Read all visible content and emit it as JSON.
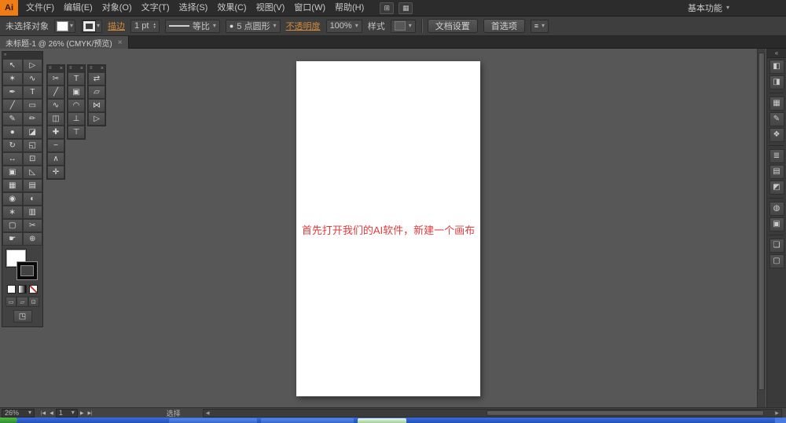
{
  "colors": {
    "accent_orange": "#cf8a3c",
    "annotation_red": "#e03a3a",
    "logo_orange": "#ef7d16",
    "taskbar_blue": "#2f5fd3",
    "artboard_white": "#ffffff"
  },
  "glyphs": {
    "caret_down": "▾",
    "close": "×",
    "collapse": "«",
    "grip": "≡",
    "stepper_up": "▴",
    "stepper_down": "▾",
    "nav_first": "|◀",
    "nav_prev": "◀",
    "nav_next": "▶",
    "nav_last": "▶|"
  },
  "menu_bar": {
    "logo": "Ai",
    "items": [
      "文件(F)",
      "编辑(E)",
      "对象(O)",
      "文字(T)",
      "选择(S)",
      "效果(C)",
      "视图(V)",
      "窗口(W)",
      "帮助(H)"
    ],
    "app_icons": [
      {
        "name": "bridge-icon",
        "glyph": "⊞"
      },
      {
        "name": "arrange-documents-icon",
        "glyph": "▦"
      }
    ],
    "workspace": "基本功能"
  },
  "control_bar": {
    "selection_status": "未选择对象",
    "stroke_link": "描边",
    "stroke_weight": "1 pt",
    "profile_value": "等比",
    "brush_icon": "●",
    "brush_value": "5 点圆形",
    "opacity_link": "不透明度",
    "opacity_value": "100%",
    "style_label": "样式",
    "doc_setup_button": "文档设置",
    "preferences_button": "首选项"
  },
  "document_tab": {
    "title": "未标题-1 @ 26% (CMYK/预览)"
  },
  "toolbar": {
    "tools": [
      {
        "name": "selection-tool",
        "glyph": "↖"
      },
      {
        "name": "direct-selection-tool",
        "glyph": "▷"
      },
      {
        "name": "magic-wand-tool",
        "glyph": "✶"
      },
      {
        "name": "lasso-tool",
        "glyph": "∿"
      },
      {
        "name": "pen-tool",
        "glyph": "✒"
      },
      {
        "name": "type-tool",
        "glyph": "T"
      },
      {
        "name": "line-segment-tool",
        "glyph": "╱"
      },
      {
        "name": "rectangle-tool",
        "glyph": "▭"
      },
      {
        "name": "paintbrush-tool",
        "glyph": "✎"
      },
      {
        "name": "pencil-tool",
        "glyph": "✏"
      },
      {
        "name": "blob-brush-tool",
        "glyph": "●"
      },
      {
        "name": "eraser-tool",
        "glyph": "◪"
      },
      {
        "name": "rotate-tool",
        "glyph": "↻"
      },
      {
        "name": "scale-tool",
        "glyph": "◱"
      },
      {
        "name": "width-tool",
        "glyph": "↔"
      },
      {
        "name": "free-transform-tool",
        "glyph": "⊡"
      },
      {
        "name": "shape-builder-tool",
        "glyph": "▣"
      },
      {
        "name": "perspective-grid-tool",
        "glyph": "◺"
      },
      {
        "name": "mesh-tool",
        "glyph": "▦"
      },
      {
        "name": "gradient-tool",
        "glyph": "▤"
      },
      {
        "name": "eyedropper-tool",
        "glyph": "◉"
      },
      {
        "name": "blend-tool",
        "glyph": "◐"
      },
      {
        "name": "symbol-sprayer-tool",
        "glyph": "∗"
      },
      {
        "name": "column-graph-tool",
        "glyph": "▥"
      },
      {
        "name": "artboard-tool",
        "glyph": "▢"
      },
      {
        "name": "slice-tool",
        "glyph": "✂"
      },
      {
        "name": "hand-tool",
        "glyph": "☛"
      },
      {
        "name": "zoom-tool",
        "glyph": "⊕"
      }
    ],
    "draw_modes": [
      {
        "name": "draw-normal-mode-button",
        "glyph": "▭"
      },
      {
        "name": "draw-behind-mode-button",
        "glyph": "▱"
      },
      {
        "name": "draw-inside-mode-button",
        "glyph": "⊡"
      }
    ],
    "screen_mode_glyph": "◳"
  },
  "palettes": {
    "a": [
      {
        "name": "scissors-tool",
        "glyph": "✂"
      },
      {
        "name": "knife-tool",
        "glyph": "╱"
      },
      {
        "name": "smooth-tool",
        "glyph": "∿"
      },
      {
        "name": "path-eraser-tool",
        "glyph": "◫"
      },
      {
        "name": "add-anchor-point-tool",
        "glyph": "✚"
      },
      {
        "name": "delete-anchor-point-tool",
        "glyph": "−"
      },
      {
        "name": "convert-anchor-point-tool",
        "glyph": "∧"
      },
      {
        "name": "measure-tool",
        "glyph": "✛"
      }
    ],
    "b": [
      {
        "name": "type-tool",
        "glyph": "T"
      },
      {
        "name": "area-type-tool",
        "glyph": "▣"
      },
      {
        "name": "type-on-path-tool",
        "glyph": "◠"
      },
      {
        "name": "vertical-type-tool",
        "glyph": "⊥"
      },
      {
        "name": "vertical-area-type-tool",
        "glyph": "⊤"
      }
    ],
    "c": [
      {
        "name": "reflect-tool",
        "glyph": "⇄"
      },
      {
        "name": "shear-tool",
        "glyph": "▱"
      },
      {
        "name": "reshape-tool",
        "glyph": "⋈"
      },
      {
        "name": "group-selection-tool",
        "glyph": "▷"
      }
    ]
  },
  "dock": {
    "items": [
      {
        "name": "color-panel-icon",
        "glyph": "◧",
        "inter": "true"
      },
      {
        "name": "color-guide-panel-icon",
        "glyph": "◨",
        "inter": "true"
      },
      {
        "name": "separator",
        "glyph": "",
        "inter": "false"
      },
      {
        "name": "swatches-panel-icon",
        "glyph": "▦",
        "inter": "true"
      },
      {
        "name": "brushes-panel-icon",
        "glyph": "✎",
        "inter": "true"
      },
      {
        "name": "symbols-panel-icon",
        "glyph": "❖",
        "inter": "true"
      },
      {
        "name": "separator",
        "glyph": "",
        "inter": "false"
      },
      {
        "name": "stroke-panel-icon",
        "glyph": "≣",
        "inter": "true"
      },
      {
        "name": "gradient-panel-icon",
        "glyph": "▤",
        "inter": "true"
      },
      {
        "name": "transparency-panel-icon",
        "glyph": "◩",
        "inter": "true"
      },
      {
        "name": "separator",
        "glyph": "",
        "inter": "false"
      },
      {
        "name": "appearance-panel-icon",
        "glyph": "◍",
        "inter": "true"
      },
      {
        "name": "graphic-styles-panel-icon",
        "glyph": "▣",
        "inter": "true"
      },
      {
        "name": "separator",
        "glyph": "",
        "inter": "false"
      },
      {
        "name": "layers-panel-icon",
        "glyph": "❏",
        "inter": "true"
      },
      {
        "name": "artboards-panel-icon",
        "glyph": "▢",
        "inter": "true"
      }
    ]
  },
  "canvas": {
    "annotation": "首先打开我们的AI软件，新建一个画布"
  },
  "status_bar": {
    "zoom": "26%",
    "artboard_number": "1",
    "status": "选择"
  }
}
